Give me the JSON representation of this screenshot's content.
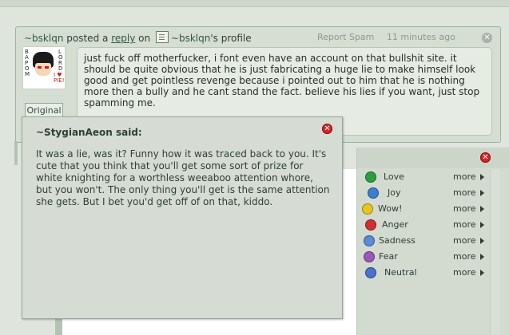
{
  "comment": {
    "author": "~bsklqn",
    "posted_text": "posted a",
    "reply_link": "reply",
    "on_text": "on",
    "profile_owner": "~bsklqn",
    "profile_suffix": "'s profile",
    "report_label": "Report Spam",
    "time_label": "11 minutes ago",
    "original_button": "Original",
    "body": "just fuck off motherfucker, i font even have an account on that bullshit site. it should be quite obvious that he is just fabricating a huge lie to make himself look good and get pointless revenge because i pointed out to him that he is nothing more then a bully and he cant stand the fact. believe his lies if you want, just stop spamming me.",
    "avatar_letters_left": "B A P O M",
    "avatar_letters_right": "L O R D",
    "avatar_badge": "I ♥ PIE!"
  },
  "popup": {
    "title": "~StygianAeon said:",
    "body": "It was a lie, was it? Funny how it was traced back to you. It's cute that you think that you'll get some sort of prize for white knighting for a worthless weeaboo attention whore, but you won't. The only thing you'll get is the same attention she gets. But I bet you'd get off of on that, kiddo."
  },
  "reactions": [
    {
      "label": "Love",
      "icon": "love-face-icon",
      "color": "#2e9e3a",
      "more": "more"
    },
    {
      "label": "Joy",
      "icon": "joy-face-icon",
      "color": "#3a7fd0",
      "more": "more"
    },
    {
      "label": "Wow!",
      "icon": "wow-face-icon",
      "color": "#e8c620",
      "more": "more"
    },
    {
      "label": "Anger",
      "icon": "anger-face-icon",
      "color": "#d03030",
      "more": "more"
    },
    {
      "label": "Sadness",
      "icon": "sadness-face-icon",
      "color": "#5a8ad8",
      "more": "more"
    },
    {
      "label": "Fear",
      "icon": "fear-face-icon",
      "color": "#9a58b8",
      "more": "more"
    },
    {
      "label": "Neutral",
      "icon": "neutral-face-icon",
      "color": "#4a72c8",
      "more": "more"
    }
  ]
}
